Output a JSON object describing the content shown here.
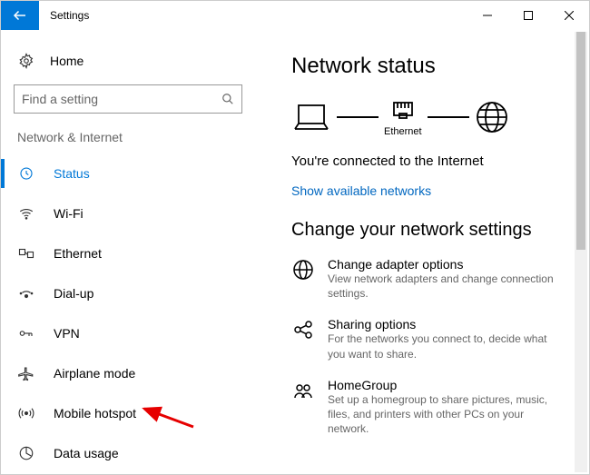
{
  "window": {
    "title": "Settings"
  },
  "sidebar": {
    "home_label": "Home",
    "search_placeholder": "Find a setting",
    "category": "Network & Internet",
    "items": [
      {
        "label": "Status"
      },
      {
        "label": "Wi-Fi"
      },
      {
        "label": "Ethernet"
      },
      {
        "label": "Dial-up"
      },
      {
        "label": "VPN"
      },
      {
        "label": "Airplane mode"
      },
      {
        "label": "Mobile hotspot"
      },
      {
        "label": "Data usage"
      }
    ]
  },
  "main": {
    "heading": "Network status",
    "diagram_label": "Ethernet",
    "status_message": "You're connected to the Internet",
    "link_text": "Show available networks",
    "subheading": "Change your network settings",
    "settings": [
      {
        "title": "Change adapter options",
        "desc": "View network adapters and change connection settings."
      },
      {
        "title": "Sharing options",
        "desc": "For the networks you connect to, decide what you want to share."
      },
      {
        "title": "HomeGroup",
        "desc": "Set up a homegroup to share pictures, music, files, and printers with other PCs on your network."
      }
    ]
  }
}
